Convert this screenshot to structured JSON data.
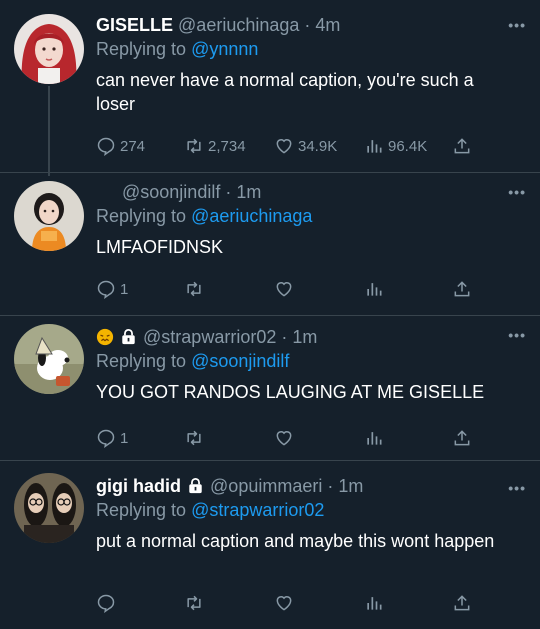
{
  "theme": {
    "background": "#15202b",
    "muted": "#8899a6",
    "link": "#1d9bf0",
    "line": "#38444d"
  },
  "tweets": [
    {
      "display_name": "GISELLE",
      "handle": "@aeriuchinaga",
      "time": "· 4m",
      "replying_label": "Replying to",
      "replying_to": "@ynnnn",
      "text": "can never have a normal caption, you're such a loser",
      "replies": "274",
      "retweets": "2,734",
      "likes": "34.9K",
      "views": "96.4K",
      "avatar": "avatar-red-hair"
    },
    {
      "display_name": "",
      "handle": "@soonjindilf",
      "time": "· 1m",
      "replying_label": "Replying to",
      "replying_to": "@aeriuchinaga",
      "text": "LMFAOFIDNSK",
      "replies": "1",
      "avatar": "avatar-orange-top"
    },
    {
      "display_name": "",
      "handle": "@strapwarrior02",
      "time": "· 1m",
      "replying_label": "Replying to",
      "replying_to": "@soonjindilf",
      "text": "YOU GOT RANDOS LAUGING AT ME GISELLE",
      "replies": "1",
      "avatar": "avatar-snoopy",
      "name_icons": [
        "confounded-emoji",
        "lock-icon"
      ]
    },
    {
      "display_name": "gigi hadid",
      "handle": "@opuimmaeri",
      "time": "· 1m",
      "replying_label": "Replying to",
      "replying_to": "@strapwarrior02",
      "text": "put a normal caption and maybe this wont happen",
      "avatar": "avatar-two-faces",
      "name_icons": [
        "lock-icon"
      ]
    }
  ]
}
